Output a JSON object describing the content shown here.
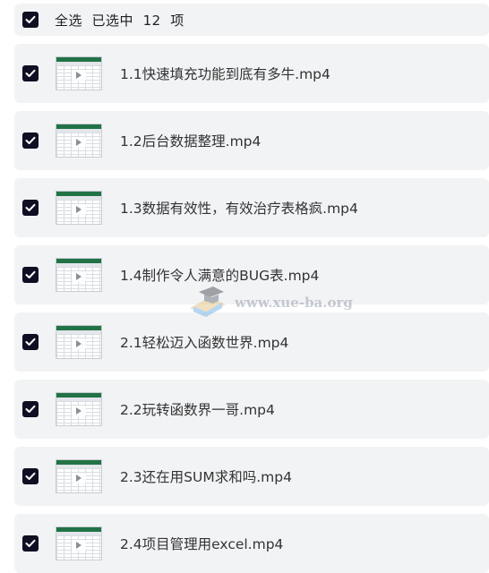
{
  "header": {
    "select_all_label": "全选  已选中  12  项",
    "checked": true
  },
  "files": [
    {
      "name": "1.1快速填充功能到底有多牛.mp4",
      "checked": true
    },
    {
      "name": "1.2后台数据整理.mp4",
      "checked": true
    },
    {
      "name": "1.3数据有效性，有效治疗表格疯.mp4",
      "checked": true
    },
    {
      "name": "1.4制作令人满意的BUG表.mp4",
      "checked": true
    },
    {
      "name": "2.1轻松迈入函数世界.mp4",
      "checked": true
    },
    {
      "name": "2.2玩转函数界一哥.mp4",
      "checked": true
    },
    {
      "name": "2.3还在用SUM求和吗.mp4",
      "checked": true
    },
    {
      "name": "2.4项目管理用excel.mp4",
      "checked": true
    }
  ],
  "watermark": {
    "text": "www.xue-ba.org"
  },
  "colors": {
    "checkbox": "#0f0f23",
    "row_background": "#f2f3f5",
    "thumbnail_accent": "#217346"
  },
  "icons": {
    "checkbox": "check-icon",
    "thumbnail": "play-icon",
    "watermark": "graduation-cap-icon"
  }
}
